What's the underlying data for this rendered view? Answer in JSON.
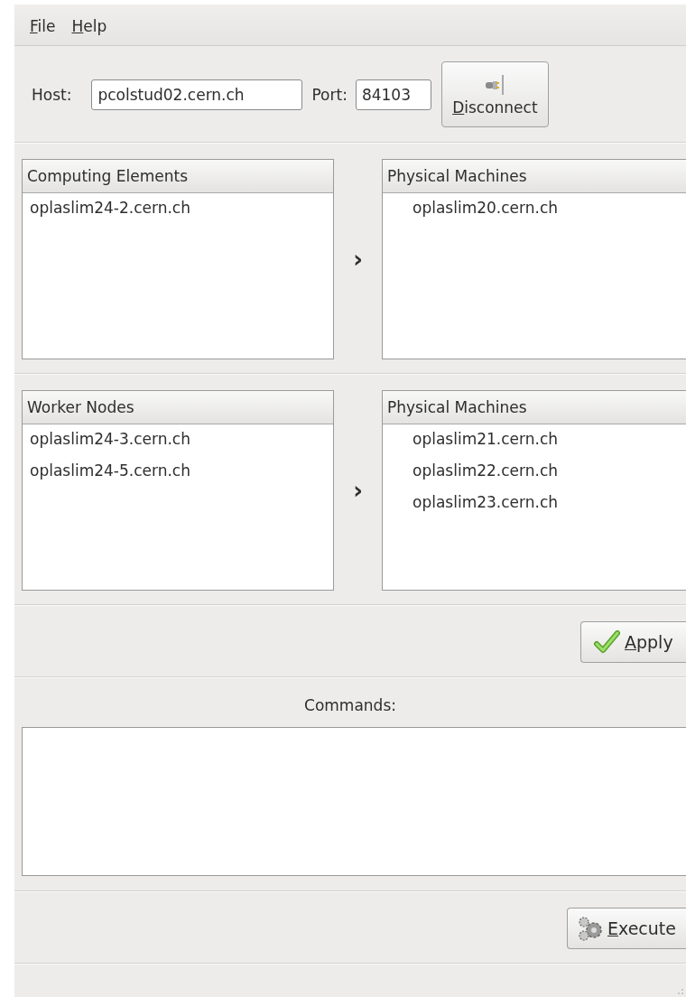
{
  "menu": [
    {
      "label": "File",
      "mnemonic": true
    },
    {
      "label": "Help",
      "mnemonic": true
    }
  ],
  "connection": {
    "host_label": "Host:",
    "host": "pcolstud02.cern.ch",
    "port_label": "Port:",
    "port": "84103",
    "button": {
      "label": "Disconnect",
      "mnemonic": true
    }
  },
  "sections": [
    {
      "left": {
        "header": "Computing Elements",
        "items": [
          "oplaslim24-2.cern.ch"
        ]
      },
      "arrow": "›",
      "right": {
        "header": "Physical Machines",
        "items": [
          "oplaslim20.cern.ch"
        ]
      }
    },
    {
      "left": {
        "header": "Worker Nodes",
        "items": [
          "oplaslim24-3.cern.ch",
          "oplaslim24-5.cern.ch"
        ]
      },
      "arrow": "›",
      "right": {
        "header": "Physical Machines",
        "items": [
          "oplaslim21.cern.ch",
          "oplaslim22.cern.ch",
          "oplaslim23.cern.ch"
        ]
      }
    }
  ],
  "apply_button": {
    "label": "Apply",
    "mnemonic": true
  },
  "commands": {
    "label": "Commands:"
  },
  "execute_button": {
    "label": "Execute",
    "mnemonic": true
  }
}
